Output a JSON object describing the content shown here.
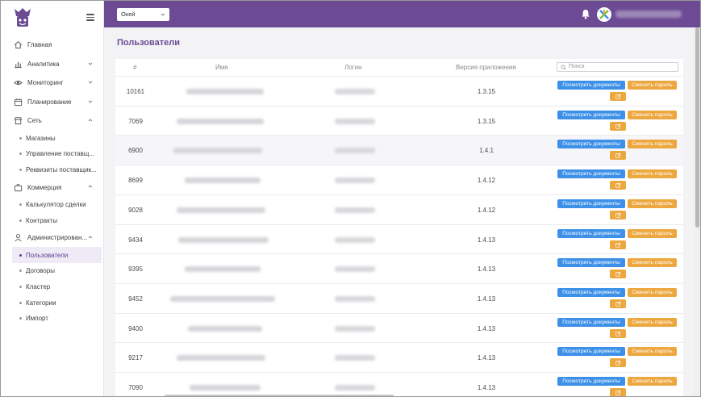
{
  "header": {
    "company": "Окей"
  },
  "sidebar": {
    "items": [
      {
        "label": "Главная",
        "icon": "home-icon"
      },
      {
        "label": "Аналитика",
        "icon": "chart-icon"
      },
      {
        "label": "Мониторинг",
        "icon": "eye-icon"
      },
      {
        "label": "Планирование",
        "icon": "calendar-icon"
      },
      {
        "label": "Сеть",
        "icon": "store-icon"
      },
      {
        "label": "Магазины"
      },
      {
        "label": "Управление поставщ..."
      },
      {
        "label": "Реквизиты поставщик..."
      },
      {
        "label": "Коммерция",
        "icon": "briefcase-icon"
      },
      {
        "label": "Калькулятор сделки"
      },
      {
        "label": "Контракты"
      },
      {
        "label": "Администрирован...",
        "icon": "user-icon"
      },
      {
        "label": "Пользователи"
      },
      {
        "label": "Договоры"
      },
      {
        "label": "Кластер"
      },
      {
        "label": "Категории"
      },
      {
        "label": "Импорт"
      }
    ]
  },
  "page": {
    "title": "Пользователи"
  },
  "table": {
    "columns": {
      "id": "#",
      "name": "Имя",
      "login": "Логин",
      "version": "Версия приложения"
    },
    "search_placeholder": "Поиск",
    "actions": {
      "docs": "Посмотреть документы",
      "password": "Сменить пароль"
    },
    "rows": [
      {
        "id": "10161",
        "version": "1.3.15"
      },
      {
        "id": "7069",
        "version": "1.3.15"
      },
      {
        "id": "6900",
        "version": "1.4.1"
      },
      {
        "id": "8699",
        "version": "1.4.12"
      },
      {
        "id": "9028",
        "version": "1.4.12"
      },
      {
        "id": "9434",
        "version": "1.4.13"
      },
      {
        "id": "9395",
        "version": "1.4.13"
      },
      {
        "id": "9452",
        "version": "1.4.13"
      },
      {
        "id": "9400",
        "version": "1.4.13"
      },
      {
        "id": "9217",
        "version": "1.4.13"
      },
      {
        "id": "7090",
        "version": "1.4.13"
      }
    ]
  },
  "colors": {
    "brand": "#6c4a94",
    "docs_button": "#3d90e8",
    "password_button": "#eda73f"
  }
}
